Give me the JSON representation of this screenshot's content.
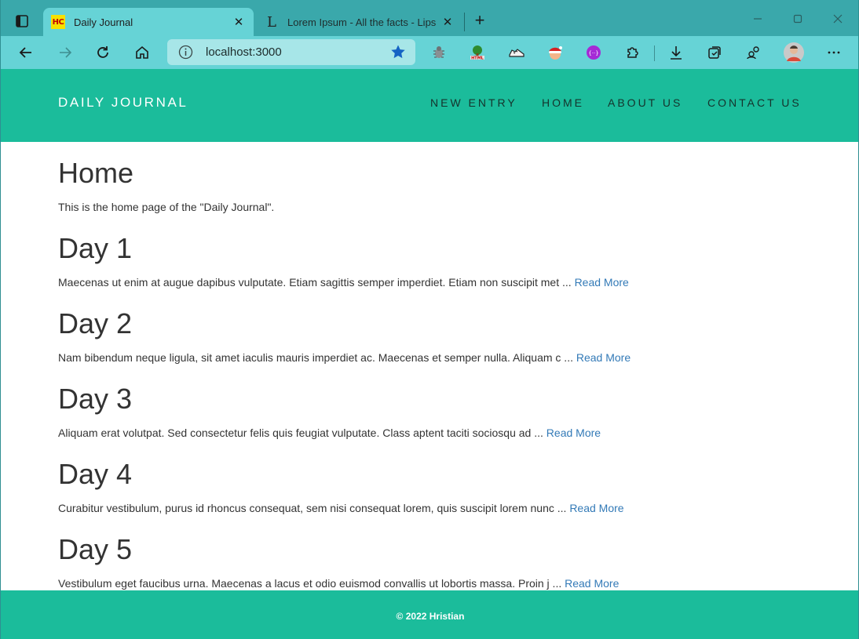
{
  "browser": {
    "tabs": [
      {
        "title": "Daily Journal",
        "favicon": "HC",
        "active": true
      },
      {
        "title": "Lorem Ipsum - All the facts - Lipsum generator",
        "favicon": "L",
        "active": false
      }
    ],
    "address": "localhost:3000",
    "icons": {
      "tab_actions": "tab-actions-icon",
      "back": "back-arrow-icon",
      "forward": "forward-arrow-icon",
      "reload": "reload-icon",
      "home": "home-icon",
      "info": "info-icon",
      "favorite": "star-icon",
      "downloads": "download-icon",
      "more": "more-icon"
    },
    "accent_color": "#66d3d6"
  },
  "site": {
    "brand": "DAILY JOURNAL",
    "nav": [
      {
        "label": "NEW ENTRY"
      },
      {
        "label": "HOME"
      },
      {
        "label": "ABOUT US"
      },
      {
        "label": "CONTACT US"
      }
    ],
    "primary_color": "#1bbc9b",
    "link_color": "#337ab7"
  },
  "home": {
    "title": "Home",
    "intro": "This is the home page of the \"Daily Journal\"."
  },
  "posts": [
    {
      "title": "Day 1",
      "excerpt": "Maecenas ut enim at augue dapibus vulputate. Etiam sagittis semper imperdiet. Etiam non suscipit met ...",
      "link": "Read More"
    },
    {
      "title": "Day 2",
      "excerpt": "Nam bibendum neque ligula, sit amet iaculis mauris imperdiet ac. Maecenas et semper nulla. Aliquam c ...",
      "link": "Read More"
    },
    {
      "title": "Day 3",
      "excerpt": "Aliquam erat volutpat. Sed consectetur felis quis feugiat vulputate. Class aptent taciti sociosqu ad ...",
      "link": "Read More"
    },
    {
      "title": "Day 4",
      "excerpt": "Curabitur vestibulum, purus id rhoncus consequat, sem nisi consequat lorem, quis suscipit lorem nunc ...",
      "link": "Read More"
    },
    {
      "title": "Day 5",
      "excerpt": "Vestibulum eget faucibus urna. Maecenas a lacus et odio euismod convallis ut lobortis massa. Proin j ...",
      "link": "Read More"
    }
  ],
  "footer": {
    "text": "© 2022 Hristian"
  }
}
